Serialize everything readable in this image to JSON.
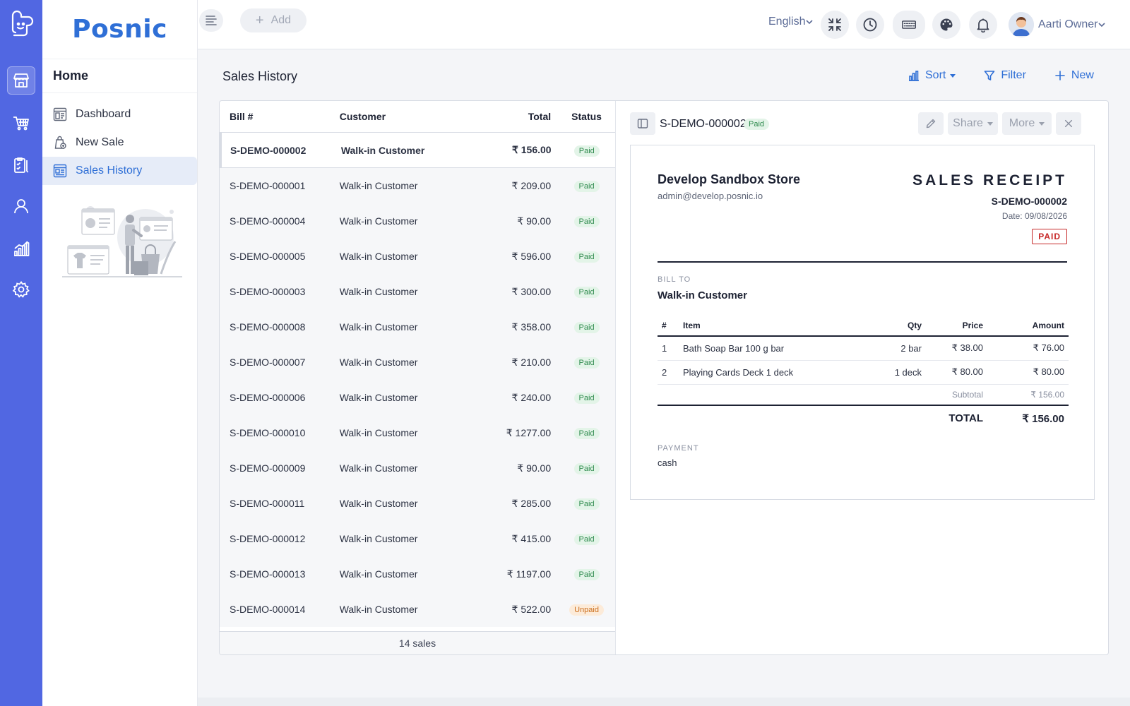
{
  "app": {
    "brand": "Posnic"
  },
  "rail": {
    "logo_icon": "app-logo-icon",
    "items": [
      {
        "icon": "store-icon",
        "active": true
      },
      {
        "icon": "cart-icon",
        "active": false
      },
      {
        "icon": "clipboard-icon",
        "active": false
      },
      {
        "icon": "user-icon",
        "active": false
      },
      {
        "icon": "bar-chart-icon",
        "active": false
      },
      {
        "icon": "gear-icon",
        "active": false
      }
    ]
  },
  "sidebar": {
    "title": "Home",
    "items": [
      {
        "label": "Dashboard",
        "icon": "dashboard-icon",
        "active": false
      },
      {
        "label": "New Sale",
        "icon": "new-sale-icon",
        "active": false
      },
      {
        "label": "Sales History",
        "icon": "sales-history-icon",
        "active": true
      }
    ]
  },
  "topbar": {
    "add_label": "Add",
    "language": "English",
    "user_name": "Aarti Owner",
    "icons": [
      "fullscreen-icon",
      "clock-icon",
      "keyboard-icon",
      "palette-icon",
      "bell-icon"
    ]
  },
  "page": {
    "title": "Sales History",
    "actions": {
      "sort": "Sort",
      "filter": "Filter",
      "new": "New"
    }
  },
  "list": {
    "headers": {
      "bill": "Bill #",
      "customer": "Customer",
      "total": "Total",
      "status": "Status"
    },
    "rows": [
      {
        "bill": "S-DEMO-000002",
        "customer": "Walk-in Customer",
        "total": "₹ 156.00",
        "status": "Paid",
        "selected": true
      },
      {
        "bill": "S-DEMO-000001",
        "customer": "Walk-in Customer",
        "total": "₹ 209.00",
        "status": "Paid"
      },
      {
        "bill": "S-DEMO-000004",
        "customer": "Walk-in Customer",
        "total": "₹ 90.00",
        "status": "Paid"
      },
      {
        "bill": "S-DEMO-000005",
        "customer": "Walk-in Customer",
        "total": "₹ 596.00",
        "status": "Paid"
      },
      {
        "bill": "S-DEMO-000003",
        "customer": "Walk-in Customer",
        "total": "₹ 300.00",
        "status": "Paid"
      },
      {
        "bill": "S-DEMO-000008",
        "customer": "Walk-in Customer",
        "total": "₹ 358.00",
        "status": "Paid"
      },
      {
        "bill": "S-DEMO-000007",
        "customer": "Walk-in Customer",
        "total": "₹ 210.00",
        "status": "Paid"
      },
      {
        "bill": "S-DEMO-000006",
        "customer": "Walk-in Customer",
        "total": "₹ 240.00",
        "status": "Paid"
      },
      {
        "bill": "S-DEMO-000010",
        "customer": "Walk-in Customer",
        "total": "₹ 1277.00",
        "status": "Paid"
      },
      {
        "bill": "S-DEMO-000009",
        "customer": "Walk-in Customer",
        "total": "₹ 90.00",
        "status": "Paid"
      },
      {
        "bill": "S-DEMO-000011",
        "customer": "Walk-in Customer",
        "total": "₹ 285.00",
        "status": "Paid"
      },
      {
        "bill": "S-DEMO-000012",
        "customer": "Walk-in Customer",
        "total": "₹ 415.00",
        "status": "Paid"
      },
      {
        "bill": "S-DEMO-000013",
        "customer": "Walk-in Customer",
        "total": "₹ 1197.00",
        "status": "Paid"
      },
      {
        "bill": "S-DEMO-000014",
        "customer": "Walk-in Customer",
        "total": "₹ 522.00",
        "status": "Unpaid"
      }
    ],
    "footer": "14 sales"
  },
  "detail": {
    "bill_no": "S-DEMO-000002",
    "status": "Paid",
    "share_label": "Share",
    "more_label": "More",
    "receipt": {
      "store_name": "Develop Sandbox Store",
      "store_email": "admin@develop.posnic.io",
      "title": "SALES RECEIPT",
      "number": "S-DEMO-000002",
      "date": "Date: 09/08/2026",
      "stamp": "PAID",
      "bill_to_label": "BILL TO",
      "bill_to_name": "Walk-in Customer",
      "table_headers": {
        "n": "#",
        "item": "Item",
        "qty": "Qty",
        "price": "Price",
        "amount": "Amount"
      },
      "items": [
        {
          "n": "1",
          "item": "Bath Soap Bar 100 g bar",
          "qty": "2 bar",
          "price": "₹ 38.00",
          "amount": "₹ 76.00"
        },
        {
          "n": "2",
          "item": "Playing Cards Deck 1 deck",
          "qty": "1 deck",
          "price": "₹ 80.00",
          "amount": "₹ 80.00"
        }
      ],
      "subtotal_label": "Subtotal",
      "subtotal": "₹ 156.00",
      "total_label": "TOTAL",
      "total": "₹ 156.00",
      "payment_label": "PAYMENT",
      "payment_value": "cash"
    }
  },
  "colors": {
    "rail": "#5167e2",
    "accent": "#2f6fd6",
    "paid_bg": "#e3f4e8",
    "paid_fg": "#2f8b4e",
    "unpaid_bg": "#fcebd9",
    "unpaid_fg": "#cc6f1d",
    "stamp": "#c62828"
  }
}
